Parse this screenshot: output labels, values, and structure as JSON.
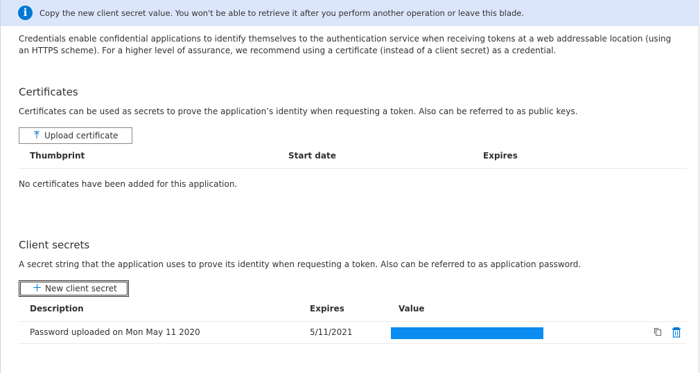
{
  "info_bar": {
    "icon": "info-icon",
    "message": "Copy the new client secret value. You won't be able to retrieve it after you perform another operation or leave this blade."
  },
  "intro": "Credentials enable confidential applications to identify themselves to the authentication service when receiving tokens at a web addressable location (using an HTTPS scheme). For a higher level of assurance, we recommend using a certificate (instead of a client secret) as a credential.",
  "certificates": {
    "title": "Certificates",
    "description": "Certificates can be used as secrets to prove the application’s identity when requesting a token. Also can be referred to as public keys.",
    "upload_button": "Upload certificate",
    "upload_icon": "upload-arrow-icon",
    "columns": [
      "Thumbprint",
      "Start date",
      "Expires"
    ],
    "empty_message": "No certificates have been added for this application."
  },
  "client_secrets": {
    "title": "Client secrets",
    "description": "A secret string that the application uses to prove its identity when requesting a token. Also can be referred to as application password.",
    "new_button": "New client secret",
    "new_icon": "plus-icon",
    "columns": [
      "Description",
      "Expires",
      "Value"
    ],
    "rows": [
      {
        "description": "Password uploaded on Mon May 11 2020",
        "expires": "5/11/2021",
        "value": "",
        "actions": [
          "copy-icon",
          "delete-icon"
        ]
      }
    ]
  },
  "colors": {
    "accent": "#0078d4",
    "info_bar_bg": "#dce6fb",
    "redaction": "#0a8cf0"
  }
}
